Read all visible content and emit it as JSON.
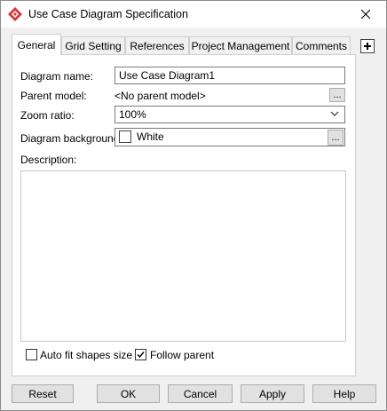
{
  "window": {
    "title": "Use Case Diagram Specification"
  },
  "tabs": [
    {
      "label": "General",
      "active": true
    },
    {
      "label": "Grid Setting",
      "active": false
    },
    {
      "label": "References",
      "active": false
    },
    {
      "label": "Project Management",
      "active": false
    },
    {
      "label": "Comments",
      "active": false
    }
  ],
  "form": {
    "diagram_name_label": "Diagram name:",
    "diagram_name_value": "Use Case Diagram1",
    "parent_model_label": "Parent model:",
    "parent_model_value": "<No parent model>",
    "zoom_ratio_label": "Zoom ratio:",
    "zoom_ratio_value": "100%",
    "background_label": "Diagram background:",
    "background_value": "White",
    "description_label": "Description:",
    "ellipsis": "..."
  },
  "options": {
    "auto_fit_label": "Auto fit shapes size",
    "auto_fit_checked": false,
    "follow_parent_label": "Follow parent",
    "follow_parent_checked": true
  },
  "buttons": {
    "reset": "Reset",
    "ok": "OK",
    "cancel": "Cancel",
    "apply": "Apply",
    "help": "Help"
  },
  "icons": {
    "app": "visual-paradigm-logo-icon",
    "close": "close-icon",
    "add_tab": "add-tab-icon"
  },
  "colors": {
    "app_icon": "#d9363e",
    "panel_bg": "#ffffff",
    "window_bg": "#f0f0f0"
  }
}
